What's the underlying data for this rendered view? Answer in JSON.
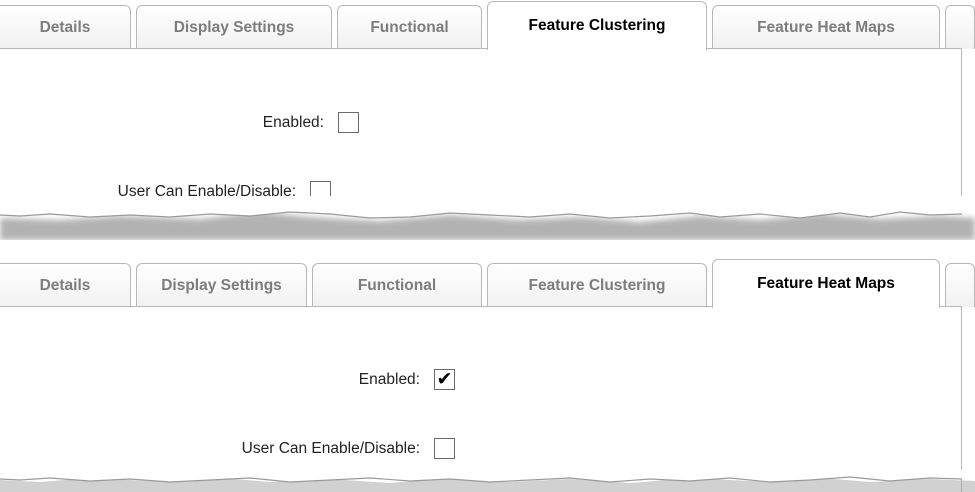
{
  "panels": [
    {
      "tabs": [
        "Details",
        "Display Settings",
        "Functional",
        "Feature Clustering",
        "Feature Heat Maps"
      ],
      "active_tab": "Feature Clustering",
      "fields": [
        {
          "label": "Enabled:",
          "checked": false
        },
        {
          "label": "User Can Enable/Disable:",
          "checked": false
        }
      ]
    },
    {
      "tabs": [
        "Details",
        "Display Settings",
        "Functional",
        "Feature Clustering",
        "Feature Heat Maps"
      ],
      "active_tab": "Feature Heat Maps",
      "fields": [
        {
          "label": "Enabled:",
          "checked": true
        },
        {
          "label": "User Can Enable/Disable:",
          "checked": false
        }
      ]
    }
  ],
  "check_glyph": "✔",
  "colors": {
    "tab_border": "#b8b8b8",
    "inactive_tab_text": "#7d7d7d",
    "active_tab_text": "#000000"
  }
}
